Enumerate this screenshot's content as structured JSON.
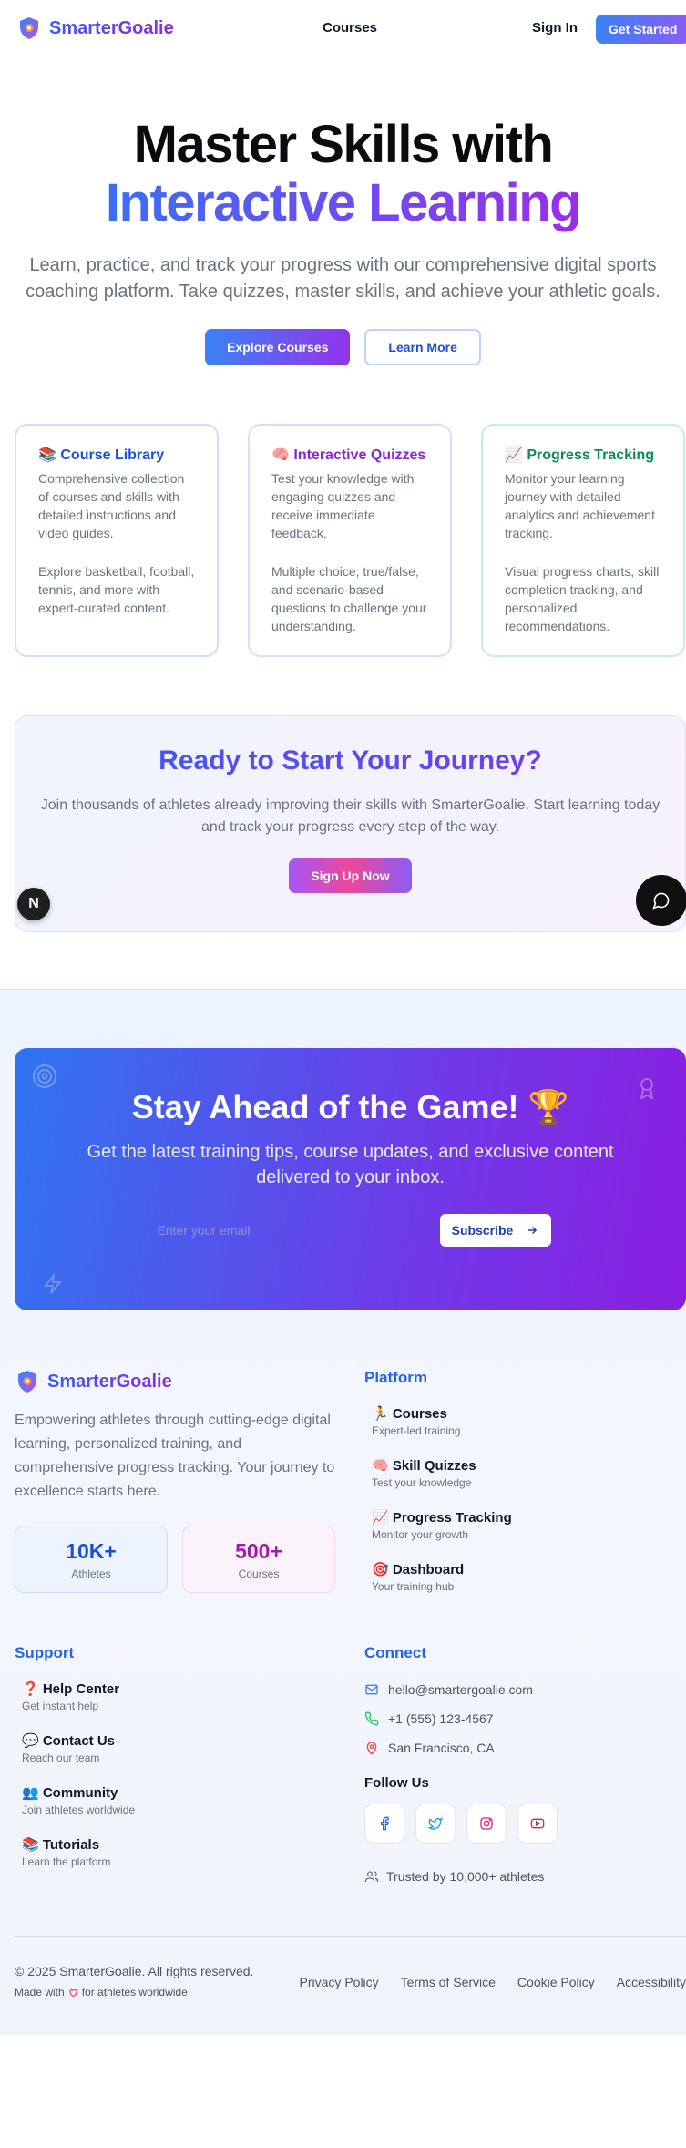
{
  "nav": {
    "brand": "SmarterGoalie",
    "courses_link": "Courses",
    "signin": "Sign In",
    "cta": "Get Started"
  },
  "hero": {
    "title_line1": "Master Skills with",
    "title_line2": "Interactive Learning",
    "subtitle": "Learn, practice, and track your progress with our comprehensive digital sports coaching platform. Take quizzes, master skills, and achieve your athletic goals.",
    "btn_primary": "Explore Courses",
    "btn_secondary": "Learn More"
  },
  "features": [
    {
      "title": "📚 Course Library",
      "p1": "Comprehensive collection of courses and skills with detailed instructions and video guides.",
      "p2": "Explore basketball, football, tennis, and more with expert-curated content."
    },
    {
      "title": "🧠 Interactive Quizzes",
      "p1": "Test your knowledge with engaging quizzes and receive immediate feedback.",
      "p2": "Multiple choice, true/false, and scenario-based questions to challenge your understanding."
    },
    {
      "title": "📈 Progress Tracking",
      "p1": "Monitor your learning journey with detailed analytics and achievement tracking.",
      "p2": "Visual progress charts, skill completion tracking, and personalized recommendations."
    }
  ],
  "ready": {
    "title": "Ready to Start Your Journey?",
    "text": "Join thousands of athletes already improving their skills with SmarterGoalie. Start learning today and track your progress every step of the way.",
    "button": "Sign Up Now",
    "badge": "N"
  },
  "newsletter": {
    "title": "Stay Ahead of the Game! 🏆",
    "text": "Get the latest training tips, course updates, and exclusive content delivered to your inbox.",
    "placeholder": "Enter your email",
    "button": "Subscribe"
  },
  "footer": {
    "brand": "SmarterGoalie",
    "description": "Empowering athletes through cutting-edge digital learning, personalized training, and comprehensive progress tracking. Your journey to excellence starts here.",
    "stats": [
      {
        "value": "10K+",
        "label": "Athletes"
      },
      {
        "value": "500+",
        "label": "Courses"
      }
    ],
    "platform": {
      "title": "Platform",
      "items": [
        {
          "title": "🏃 Courses",
          "desc": "Expert-led training"
        },
        {
          "title": "🧠 Skill Quizzes",
          "desc": "Test your knowledge"
        },
        {
          "title": "📈 Progress Tracking",
          "desc": "Monitor your growth"
        },
        {
          "title": "🎯 Dashboard",
          "desc": "Your training hub"
        }
      ]
    },
    "support": {
      "title": "Support",
      "items": [
        {
          "title": "❓ Help Center",
          "desc": "Get instant help"
        },
        {
          "title": "💬 Contact Us",
          "desc": "Reach our team"
        },
        {
          "title": "👥 Community",
          "desc": "Join athletes worldwide"
        },
        {
          "title": "📚 Tutorials",
          "desc": "Learn the platform"
        }
      ]
    },
    "connect": {
      "title": "Connect",
      "email": "hello@smartergoalie.com",
      "phone": "+1 (555) 123-4567",
      "location": "San Francisco, CA",
      "follow": "Follow Us",
      "trusted": "Trusted by 10,000+ athletes"
    },
    "copyright": "© 2025 SmarterGoalie. All rights reserved.",
    "made_with_pre": "Made with",
    "made_with_post": "for athletes worldwide",
    "legal": [
      "Privacy Policy",
      "Terms of Service",
      "Cookie Policy",
      "Accessibility"
    ]
  },
  "colors": {
    "accent_blue": "#2563eb",
    "accent_purple": "#9333ea"
  }
}
